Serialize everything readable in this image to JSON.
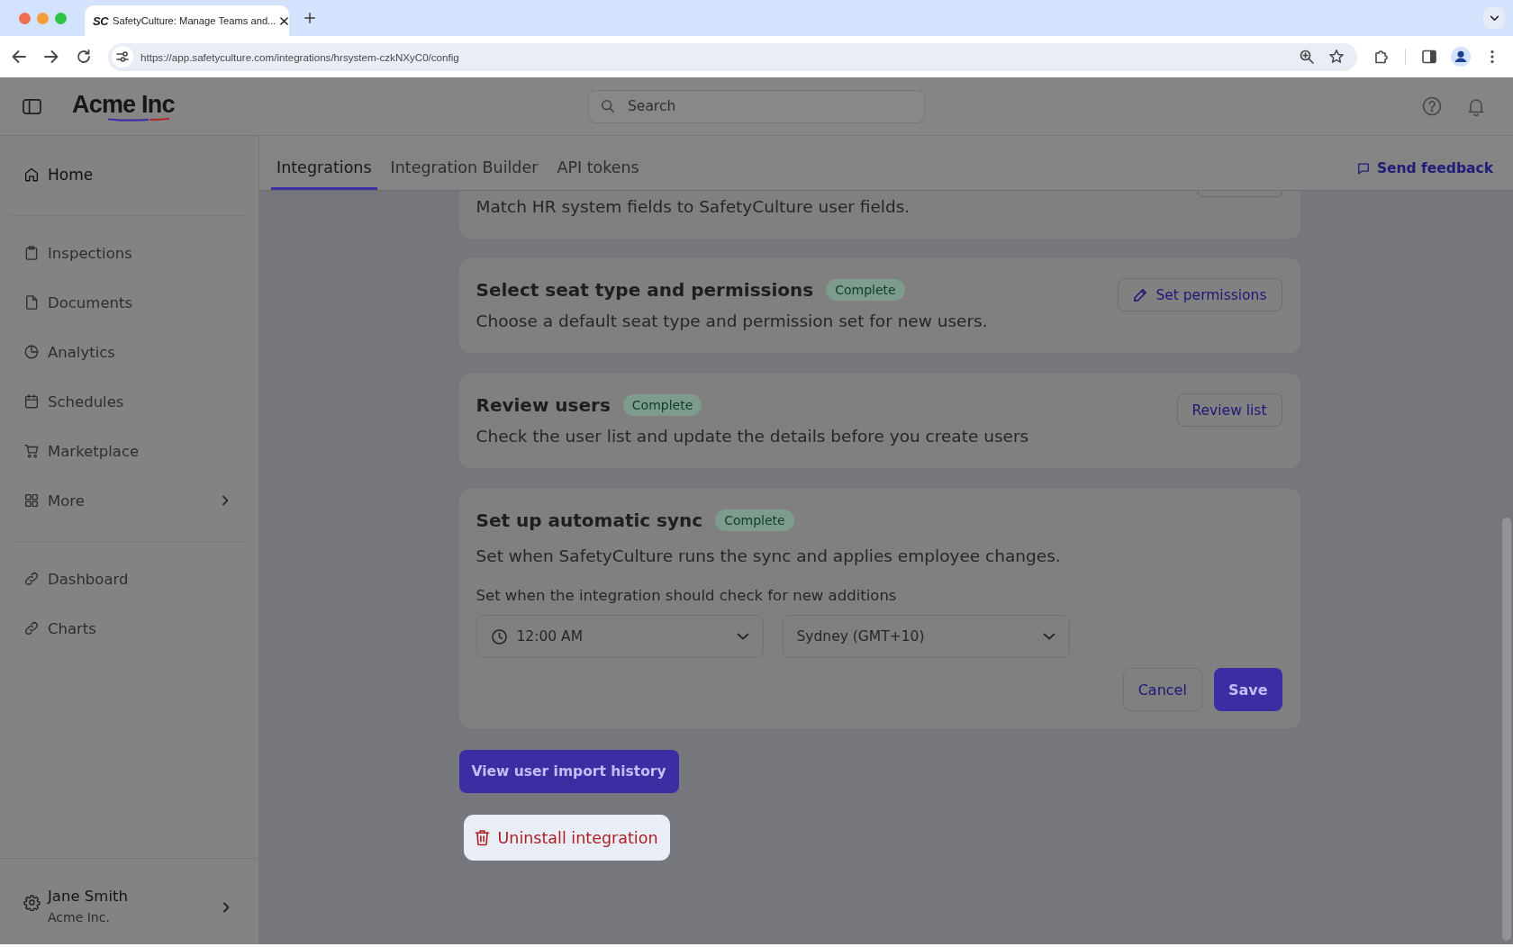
{
  "browser": {
    "tab": {
      "favicon_text": "SC",
      "title": "SafetyCulture: Manage Teams and..."
    },
    "address": "https://app.safetyculture.com/integrations/hrsystem-czkNXyC0/config"
  },
  "header": {
    "logo": "Acme Inc",
    "search": {
      "placeholder": "Search"
    }
  },
  "sidebar": {
    "groups": [
      {
        "items": [
          {
            "label": "Home",
            "kind": "link",
            "dimmed": false
          }
        ]
      },
      {
        "items": [
          {
            "label": "Inspections",
            "kind": "link",
            "dimmed": true
          },
          {
            "label": "Documents",
            "kind": "link",
            "dimmed": true
          },
          {
            "label": "Analytics",
            "kind": "link",
            "dimmed": true
          },
          {
            "label": "Schedules",
            "kind": "link",
            "dimmed": true
          },
          {
            "label": "Marketplace",
            "kind": "link",
            "dimmed": true
          },
          {
            "label": "More",
            "kind": "submenu",
            "dimmed": true
          }
        ]
      },
      {
        "items": [
          {
            "label": "Dashboard",
            "kind": "link",
            "dimmed": true
          },
          {
            "label": "Charts",
            "kind": "link",
            "dimmed": true
          }
        ]
      }
    ],
    "user": {
      "name": "Jane Smith",
      "organization": "Acme Inc."
    }
  },
  "tabs": [
    {
      "label": "Integrations",
      "selected": true
    },
    {
      "label": "Integration Builder",
      "selected": false
    },
    {
      "label": "API tokens",
      "selected": false
    }
  ],
  "send_feedback": {
    "label": "Send feedback"
  },
  "cards": [
    {
      "kind": "summary",
      "description": "Match HR system fields to SafetyCulture user fields."
    },
    {
      "kind": "step",
      "title": "Select seat type and permissions",
      "status": "Complete",
      "description": "Choose a default seat type and permission set for new users.",
      "action": {
        "label": "Set permissions",
        "kind": "icon"
      }
    },
    {
      "kind": "step",
      "title": "Review users",
      "status": "Complete",
      "description": "Check the user list and update the details before you create users",
      "action": {
        "label": "Review list",
        "kind": "text"
      }
    },
    {
      "kind": "form",
      "title": "Set up automatic sync",
      "status": "Complete",
      "description": "Set when SafetyCulture runs the sync and applies employee changes.",
      "field_label": "Set when the integration should check for new additions",
      "selects": [
        {
          "value": "12:00 AM",
          "kind": "time"
        },
        {
          "value": "Sydney (GMT+10)",
          "kind": "zone"
        }
      ],
      "buttons": [
        {
          "label": "Cancel",
          "kind": "secondary"
        },
        {
          "label": "Save",
          "kind": "primary"
        }
      ]
    }
  ],
  "history_button": {
    "label": "View user import history"
  },
  "uninstall_button": {
    "label": "Uninstall integration"
  }
}
